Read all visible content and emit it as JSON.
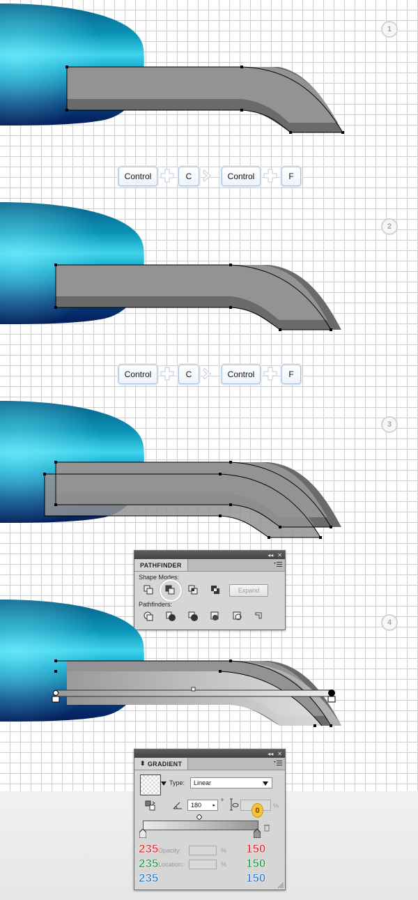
{
  "steps": [
    {
      "number": "1"
    },
    {
      "number": "2"
    },
    {
      "number": "3"
    },
    {
      "number": "4"
    }
  ],
  "shortcut": {
    "key1": "Control",
    "key2": "C",
    "key3": "Control",
    "key4": "F"
  },
  "pathfinder": {
    "title": "PATHFINDER",
    "shape_modes_label": "Shape Modes:",
    "pathfinders_label": "Pathfinders:",
    "expand_label": "Expand"
  },
  "gradient": {
    "title": "GRADIENT",
    "type_label": "Type:",
    "type_value": "Linear",
    "angle_value": "180",
    "degree_symbol": "°",
    "ratio_value": "0",
    "percent": "%",
    "opacity_label": "Opacity:",
    "location_label": "Location:",
    "left_stop": {
      "r": "235",
      "g": "235",
      "b": "235"
    },
    "right_stop": {
      "r": "150",
      "g": "150",
      "b": "150"
    }
  },
  "colors": {
    "red": "#e2262c",
    "green": "#1d9b3c",
    "blue": "#2878c8",
    "badge": "#d2d2d2",
    "handle_gray": "#979797",
    "handle_dark": "#6f6f6f"
  }
}
